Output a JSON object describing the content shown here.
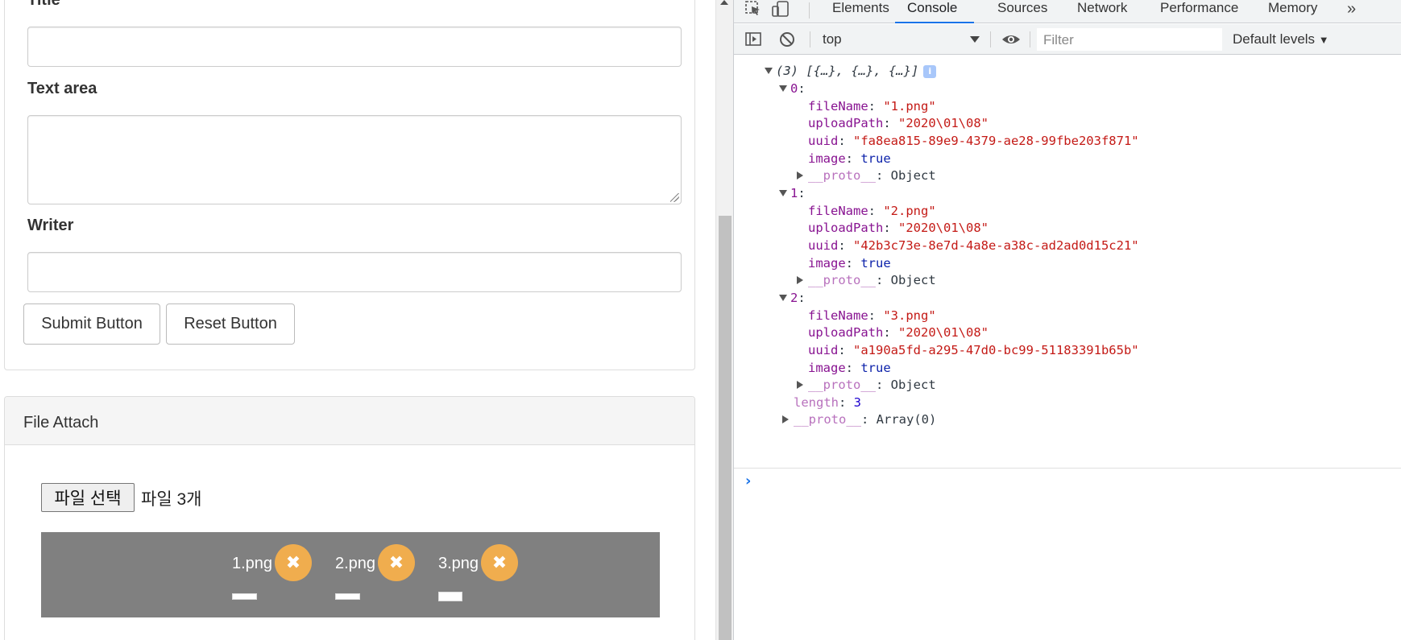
{
  "form": {
    "title_label": "Title",
    "title_value": "",
    "textarea_label": "Text area",
    "textarea_value": "",
    "writer_label": "Writer",
    "writer_value": "",
    "submit_label": "Submit Button",
    "reset_label": "Reset Button"
  },
  "attach": {
    "panel_title": "File Attach",
    "choose_button": "파일 선택",
    "file_count": "파일 3개",
    "uploads": [
      {
        "name": "1.png",
        "remove": "✖"
      },
      {
        "name": "2.png",
        "remove": "✖"
      },
      {
        "name": "3.png",
        "remove": "✖"
      }
    ]
  },
  "devtools": {
    "tabs": [
      "Elements",
      "Console",
      "Sources",
      "Network",
      "Performance",
      "Memory"
    ],
    "active_tab": "Console",
    "more": "»",
    "context": "top",
    "filter_placeholder": "Filter",
    "levels": "Default levels",
    "console": {
      "summary": "(3) [{…}, {…}, {…}]",
      "info": "i",
      "items": [
        {
          "index": "0",
          "fileName": "\"1.png\"",
          "uploadPath": "\"2020\\01\\08\"",
          "uuid": "\"fa8ea815-89e9-4379-ae28-99fbe203f871\"",
          "image": "true",
          "proto": "Object"
        },
        {
          "index": "1",
          "fileName": "\"2.png\"",
          "uploadPath": "\"2020\\01\\08\"",
          "uuid": "\"42b3c73e-8e7d-4a8e-a38c-ad2ad0d15c21\"",
          "image": "true",
          "proto": "Object"
        },
        {
          "index": "2",
          "fileName": "\"3.png\"",
          "uploadPath": "\"2020\\01\\08\"",
          "uuid": "\"a190a5fd-a295-47d0-bc99-51183391b65b\"",
          "image": "true",
          "proto": "Object"
        }
      ],
      "length_key": "length",
      "length_value": "3",
      "array_proto": "Array(0)",
      "prompt": "›"
    }
  },
  "colors": {
    "accent": "#1a73e8",
    "remove_button": "#f0ad4e",
    "upload_area": "#808080"
  }
}
